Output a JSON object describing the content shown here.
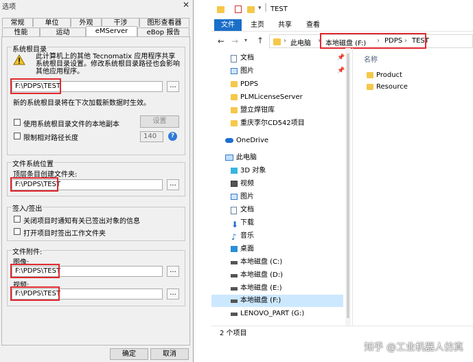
{
  "dialog": {
    "title": "选项",
    "close": "✕",
    "tabs_row1": [
      "常规",
      "单位",
      "外观",
      "干涉",
      "图形查看器"
    ],
    "tabs_row2": [
      "性能",
      "运动",
      "eMServer",
      "eBop 报告"
    ],
    "group_root": {
      "title": "系统根目录",
      "warning": "此计算机上的其他 Tecnomatix 应用程序共享系统根目录设置。修改系统根目录路径也会影响其他应用程序。",
      "path": "F:\\PDPS\\TEST",
      "note": "新的系统根目录将在下次加载新数据时生效。",
      "local_copy_label": "使用系统根目录文件的本地副本",
      "settings_button": "设置",
      "limit_path_label": "限制相对路径长度",
      "limit_value": "140",
      "help": "?"
    },
    "group_fs": {
      "title": "文件系统位置",
      "top_label": "顶层条目创建文件夹:",
      "path": "F:\\PDPS\\TEST"
    },
    "group_checkin": {
      "title": "签入/签出",
      "close_notify_label": "关闭项目时通知有关已签出对象的信息",
      "open_folder_label": "打开项目时签出工作文件夹"
    },
    "group_attach": {
      "title": "文件附件:",
      "image_label": "图像:",
      "image_path": "F:\\PDPS\\TEST",
      "video_label": "视频:",
      "video_path": "F:\\PDPS\\TEST"
    },
    "browse": "...",
    "ok": "确定",
    "cancel": "取消"
  },
  "explorer": {
    "window_title": "TEST",
    "ribbon": [
      "文件",
      "主页",
      "共享",
      "查看"
    ],
    "breadcrumb": [
      "此电脑",
      "本地磁盘 (F:)",
      "PDPS",
      "TEST"
    ],
    "sep": "›",
    "nav_back": "←",
    "nav_forward": "→",
    "nav_up": "↑",
    "quick_access": [
      {
        "label": "文档",
        "icon": "document-icon",
        "pinned": true
      },
      {
        "label": "图片",
        "icon": "picture-icon",
        "pinned": true
      },
      {
        "label": "PDPS",
        "icon": "folder-icon"
      },
      {
        "label": "PLMLicenseServer",
        "icon": "folder-icon"
      },
      {
        "label": "盟立焊钳库",
        "icon": "folder-icon"
      },
      {
        "label": "重庆李尔CD542项目",
        "icon": "folder-icon"
      }
    ],
    "onedrive": "OneDrive",
    "this_pc": "此电脑",
    "pc_items": [
      {
        "label": "3D 对象",
        "icon": "cube-icon"
      },
      {
        "label": "视频",
        "icon": "video-icon"
      },
      {
        "label": "图片",
        "icon": "picture-icon"
      },
      {
        "label": "文档",
        "icon": "document-icon"
      },
      {
        "label": "下载",
        "icon": "download-icon"
      },
      {
        "label": "音乐",
        "icon": "music-icon"
      },
      {
        "label": "桌面",
        "icon": "desktop-icon"
      },
      {
        "label": "本地磁盘 (C:)",
        "icon": "drive-icon"
      },
      {
        "label": "本地磁盘 (D:)",
        "icon": "drive-icon"
      },
      {
        "label": "本地磁盘 (E:)",
        "icon": "drive-icon"
      },
      {
        "label": "本地磁盘 (F:)",
        "icon": "drive-icon",
        "selected": true
      },
      {
        "label": "LENOVO_PART (G:)",
        "icon": "drive-icon"
      }
    ],
    "column_name": "名称",
    "files": [
      "Product",
      "Resource"
    ],
    "status": "2 个项目"
  },
  "watermark": "知乎 @工业机器人仿真",
  "colors": {
    "accent": "#1a6fc9",
    "highlight": "#e0282e",
    "selected": "#cce8ff"
  }
}
